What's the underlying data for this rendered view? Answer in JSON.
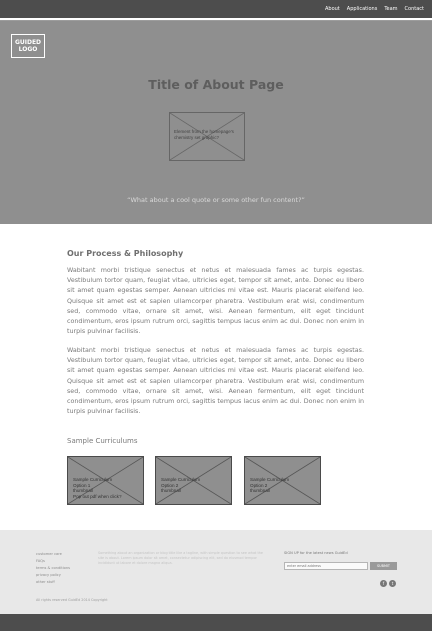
{
  "nav": {
    "items": [
      "About",
      "Applications",
      "Team",
      "Contact"
    ]
  },
  "logo": {
    "line1": "GUIDED",
    "line2": "LOGO"
  },
  "hero": {
    "title": "Title of About Page",
    "placeholder_text": "Element from the homepage's chemistry set graphic?",
    "quote": "“What about a cool quote or some other fun content?”"
  },
  "content": {
    "section_title": "Our Process & Philosophy",
    "paragraph_1": "Wabitant morbi tristique senectus et netus et malesuada fames ac turpis egestas. Vestibulum tortor quam, feugiat vitae, ultricies eget, tempor sit amet, ante. Donec eu libero sit amet quam egestas semper. Aenean ultricies mi vitae est. Mauris placerat eleifend leo. Quisque sit amet est et sapien ullamcorper pharetra. Vestibulum erat wisi, condimentum sed, commodo vitae, ornare sit amet, wisi. Aenean fermentum, elit eget tincidunt condimentum, eros ipsum rutrum orci, sagittis tempus lacus enim ac dui. Donec non enim in turpis pulvinar facilisis.",
    "paragraph_2": "Wabitant morbi tristique senectus et netus et malesuada fames ac turpis egestas. Vestibulum tortor quam, feugiat vitae, ultricies eget, tempor sit amet, ante. Donec eu libero sit amet quam egestas semper. Aenean ultricies mi vitae est. Mauris placerat eleifend leo. Quisque sit amet est et sapien ullamcorper pharetra. Vestibulum erat wisi, condimentum sed, commodo vitae, ornare sit amet, wisi. Aenean fermentum, elit eget tincidunt condimentum, eros ipsum rutrum orci, sagittis tempus lacus enim ac dui. Donec non enim in turpis pulvinar facilisis."
  },
  "curriculums": {
    "title": "Sample Curriculums",
    "cards": [
      {
        "line1": "Sample Curriculum",
        "line2": "Option 1",
        "line3": "thumbnail",
        "line4": "Pop out pdf when click?"
      },
      {
        "line1": "Sample Curriculum",
        "line2": "Option 2",
        "line3": "thumbnail",
        "line4": ""
      },
      {
        "line1": "Sample Curriculum",
        "line2": "Option 2",
        "line3": "thumbnail",
        "line4": ""
      }
    ]
  },
  "footer": {
    "links": [
      "customer care",
      "FAQs",
      "terms & conditions",
      "privacy policy",
      "other stuff"
    ],
    "blurb": "Something about an organization or blog title like a tagline, with simple question to see what the site is about. Lorem ipsum dolor sit amet, consectetur adipiscing elit, sed do eiusmod tempor incididunt ut labore et dolore magna aliqua.",
    "signup_label": "SIGN UP for the latest news GuidEd",
    "email_placeholder": "enter email address",
    "submit_label": "SUBMIT",
    "social": [
      "f",
      "t"
    ],
    "copyright": "All rights reserved GuidEd 2014 Copyright"
  }
}
